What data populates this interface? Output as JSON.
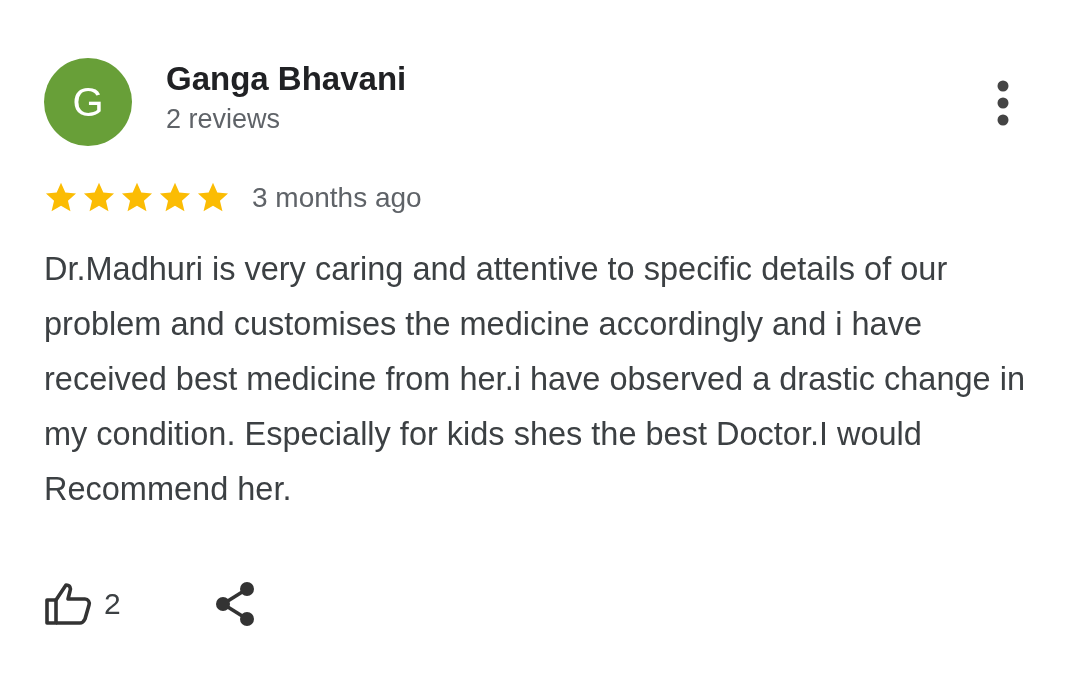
{
  "reviewer": {
    "initial": "G",
    "name": "Ganga Bhavani",
    "reviews": "2 reviews",
    "color": "#689f38"
  },
  "rating": {
    "stars": 5,
    "time": "3 months ago"
  },
  "body": "Dr.Madhuri is very caring and attentive to specific details of our problem and customises the medicine accordingly and i have received best medicine from her.i have observed a drastic change in my condition. Especially for kids shes the best Doctor.I would Recommend her.",
  "actions": {
    "likes": "2"
  }
}
